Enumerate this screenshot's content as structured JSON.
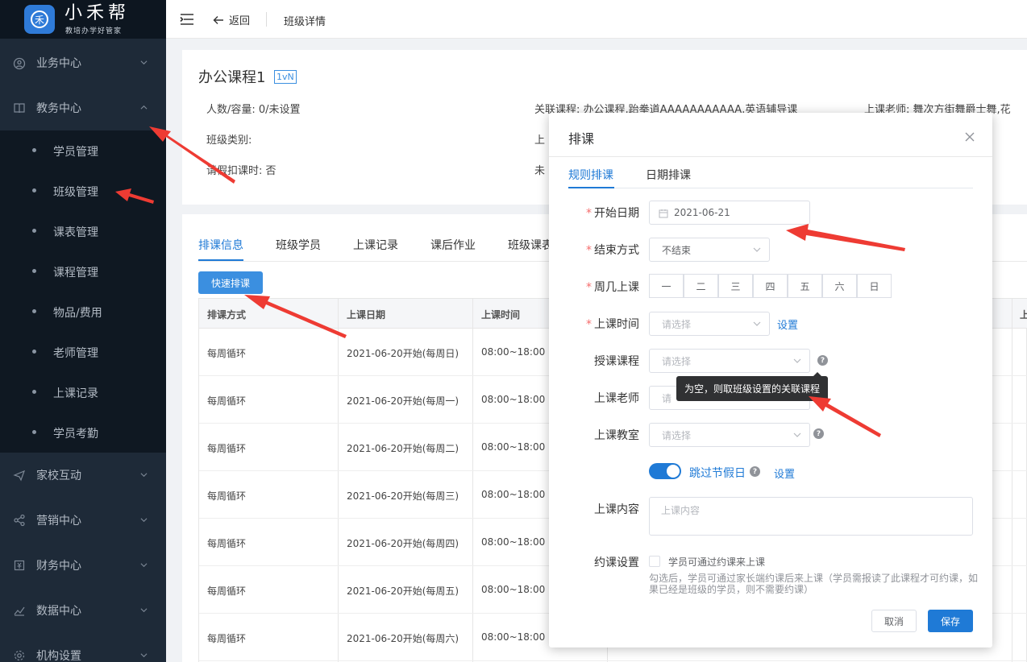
{
  "app": {
    "name": "小禾帮",
    "slogan": "教培办学好管家",
    "brand_color": "#2f7bd8"
  },
  "sidebar": {
    "groups": [
      {
        "label": "业务中心",
        "icon": "user-circle-icon"
      },
      {
        "label": "教务中心",
        "icon": "book-icon",
        "expanded": true
      },
      {
        "label": "家校互动",
        "icon": "paper-plane-icon"
      },
      {
        "label": "营销中心",
        "icon": "share-icon"
      },
      {
        "label": "财务中心",
        "icon": "finance-icon"
      },
      {
        "label": "数据中心",
        "icon": "chart-icon"
      },
      {
        "label": "机构设置",
        "icon": "gear-icon"
      }
    ],
    "sub_items": [
      "学员管理",
      "班级管理",
      "课表管理",
      "课程管理",
      "物品/费用",
      "老师管理",
      "上课记录",
      "学员考勤"
    ]
  },
  "topbar": {
    "back_label": "返回",
    "breadcrumb": "班级详情"
  },
  "class_info": {
    "title": "办公课程1",
    "badge": "1vN",
    "people": "人数/容量:  0/未设置",
    "category": "班级类别:",
    "leave_deduct": "请假扣课时:  否",
    "related_course": "关联课程:  办公课程,跆拳道AAAAAAAAAAA,英语辅导课",
    "teacher": "上课老师:  舞次方街舞爵士舞,花",
    "row2_mid": "上",
    "row3_mid": "未"
  },
  "list": {
    "tabs": [
      "排课信息",
      "班级学员",
      "上课记录",
      "课后作业",
      "班级课表"
    ],
    "quick_btn": "快速排课",
    "headers": [
      "排课方式",
      "上课日期",
      "上课时间",
      "上"
    ],
    "rows": [
      [
        "每周循环",
        "2021-06-20开始(每周日)",
        "08:00~18:00"
      ],
      [
        "每周循环",
        "2021-06-20开始(每周一)",
        "08:00~18:00"
      ],
      [
        "每周循环",
        "2021-06-20开始(每周二)",
        "08:00~18:00"
      ],
      [
        "每周循环",
        "2021-06-20开始(每周三)",
        "08:00~18:00"
      ],
      [
        "每周循环",
        "2021-06-20开始(每周四)",
        "08:00~18:00"
      ],
      [
        "每周循环",
        "2021-06-20开始(每周五)",
        "08:00~18:00"
      ],
      [
        "每周循环",
        "2021-06-20开始(每周六)",
        "08:00~18:00"
      ]
    ]
  },
  "dialog": {
    "title": "排课",
    "tabs": [
      "规则排课",
      "日期排课"
    ],
    "labels": {
      "start_date": "开始日期",
      "end_mode": "结束方式",
      "weekdays": "周几上课",
      "time": "上课时间",
      "course": "授课课程",
      "teacher": "上课老师",
      "room": "上课教室",
      "content": "上课内容",
      "booking": "约课设置"
    },
    "start_date_value": "2021-06-21",
    "end_mode_value": "不结束",
    "weekdays": [
      "一",
      "二",
      "三",
      "四",
      "五",
      "六",
      "日"
    ],
    "placeholder_select": "请选择",
    "teacher_placeholder_partial": "请",
    "set_link": "设置",
    "tooltip": "为空，则取班级设置的关联课程",
    "skip_holiday": "跳过节假日",
    "skip_holiday_on": true,
    "content_placeholder": "上课内容",
    "booking_checkbox": "学员可通过约课来上课",
    "booking_hint": "勾选后，学员可通过家长端约课后来上课（学员需报读了此课程才可约课，如果已经是班级的学员，则不需要约课）",
    "cancel": "取消",
    "save": "保存",
    "accent_color": "#1f7ad6",
    "required_color": "#f56c6c"
  },
  "annotations": {
    "arrow_color": "#ee3b33",
    "count": 6
  }
}
